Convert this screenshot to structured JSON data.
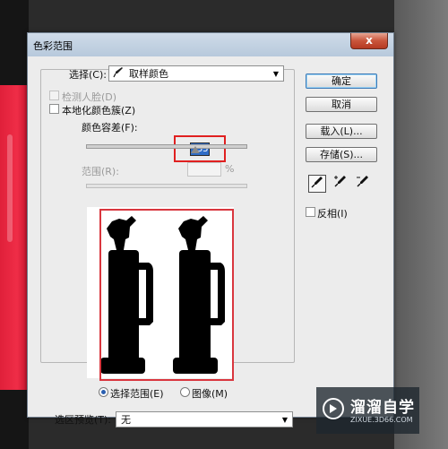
{
  "dialog": {
    "title": "色彩范围",
    "close_symbol": "x"
  },
  "select": {
    "label": "选择(C):",
    "value": "取样颜色",
    "icon": "eyedropper-icon"
  },
  "options": {
    "detect_faces": "检测人脸(D)",
    "localized_clusters": "本地化颜色簇(Z)",
    "fuzziness_label": "颜色容差(F):",
    "fuzziness_value": "135",
    "range_label": "范围(R):",
    "range_unit": "%"
  },
  "preview_mode": {
    "selection": "选择范围(E)",
    "image": "图像(M)",
    "selected": "selection"
  },
  "selection_preview": {
    "label": "选区预览(T):",
    "value": "无"
  },
  "buttons": {
    "ok": "确定",
    "cancel": "取消",
    "load": "载入(L)...",
    "save": "存储(S)..."
  },
  "tools": {
    "eyedropper": "eyedropper-icon",
    "add": "eyedropper-plus-icon",
    "subtract": "eyedropper-minus-icon"
  },
  "invert_label": "反相(I)",
  "watermark": {
    "title": "溜溜自学",
    "subtitle": "ZIXUE.3D66.COM"
  },
  "colors": {
    "highlight_red": "#e02020",
    "selection_blue": "#2f6cc6"
  }
}
